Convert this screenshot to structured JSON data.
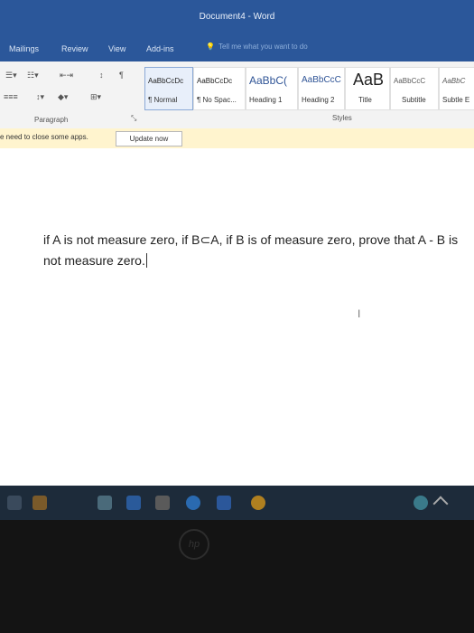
{
  "window": {
    "title": "Document4 - Word"
  },
  "tabs": [
    "Mailings",
    "Review",
    "View",
    "Add-ins"
  ],
  "tell_me": {
    "placeholder": "Tell me what you want to do"
  },
  "ribbon": {
    "paragraph_label": "Paragraph",
    "styles_label": "Styles",
    "styles": [
      {
        "sample": "AaBbCcDc",
        "name": "¶ Normal"
      },
      {
        "sample": "AaBbCcDc",
        "name": "¶ No Spac..."
      },
      {
        "sample": "AaBbC(",
        "name": "Heading 1"
      },
      {
        "sample": "AaBbCcC",
        "name": "Heading 2"
      },
      {
        "sample": "AaB",
        "name": "Title"
      },
      {
        "sample": "AaBbCcC",
        "name": "Subtitle"
      },
      {
        "sample": "AaBbC",
        "name": "Subtle E"
      }
    ]
  },
  "message_bar": {
    "text": "e need to close some apps.",
    "button": "Update now"
  },
  "document": {
    "text": "if A is not measure zero, if B⊂A, if B is of measure zero, prove that A - B is not measure zero."
  },
  "colors": {
    "title_bar": "#2b579a",
    "message_bar": "#fff4ce"
  }
}
